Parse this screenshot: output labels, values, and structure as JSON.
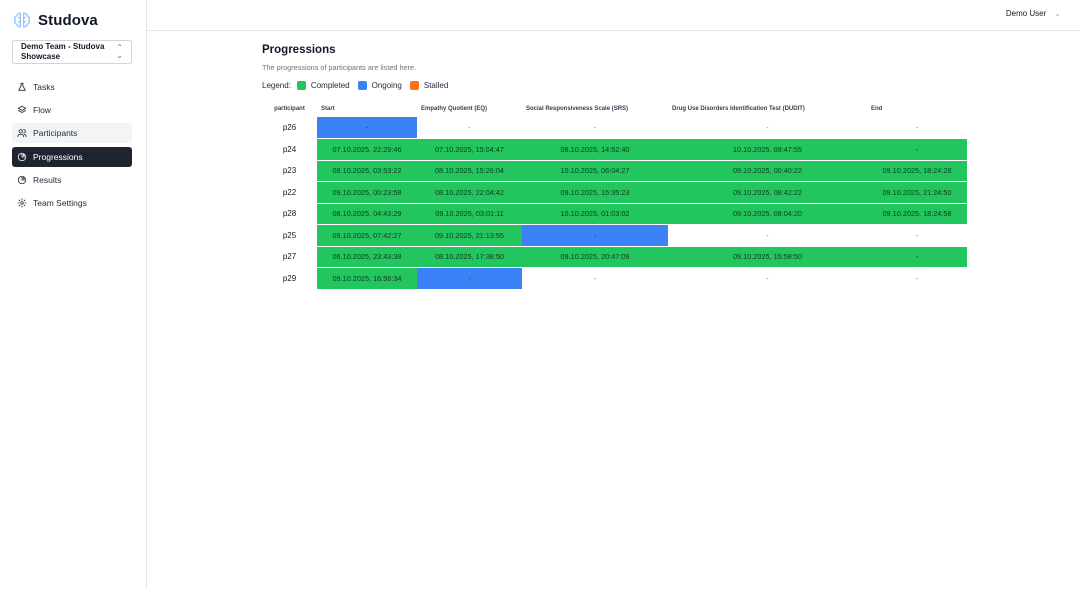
{
  "app": {
    "name": "Studova",
    "team": "Demo Team - Studova Showcase"
  },
  "sidebar": {
    "items": [
      {
        "label": "Tasks",
        "icon": "flask-icon"
      },
      {
        "label": "Flow",
        "icon": "layers-icon"
      },
      {
        "label": "Participants",
        "icon": "users-icon"
      },
      {
        "label": "Progressions",
        "icon": "pie-chart-icon"
      },
      {
        "label": "Results",
        "icon": "pie-chart-icon"
      },
      {
        "label": "Team Settings",
        "icon": "gear-icon"
      }
    ]
  },
  "header": {
    "user": "Demo User"
  },
  "page": {
    "title": "Progressions",
    "subtitle": "The progressions of participants are listed here.",
    "legend_label": "Legend:",
    "legend": [
      {
        "label": "Completed",
        "color": "#22c55e"
      },
      {
        "label": "Ongoing",
        "color": "#3b82f6"
      },
      {
        "label": "Stalled",
        "color": "#f97316"
      }
    ]
  },
  "table": {
    "columns": [
      "participant",
      "Start",
      "Empathy Quotient (EQ)",
      "Social Responsiveness Scale (SRS)",
      "Drug Use Disorders Identification Test (DUDIT)",
      "End"
    ],
    "rows": [
      {
        "participant": "p26",
        "cells": [
          {
            "value": "-",
            "status": "ongoing"
          },
          {
            "value": "-",
            "status": "empty"
          },
          {
            "value": "-",
            "status": "empty"
          },
          {
            "value": "-",
            "status": "empty"
          },
          {
            "value": "-",
            "status": "empty"
          }
        ]
      },
      {
        "participant": "p24",
        "cells": [
          {
            "value": "07.10.2025, 22:29:46",
            "status": "completed"
          },
          {
            "value": "07.10.2025, 15:04:47",
            "status": "completed"
          },
          {
            "value": "08.10.2025, 14:52:40",
            "status": "completed"
          },
          {
            "value": "10.10.2025, 09:47:55",
            "status": "completed"
          },
          {
            "value": "-",
            "status": "completed"
          }
        ]
      },
      {
        "participant": "p23",
        "cells": [
          {
            "value": "08.10.2025, 03:53:22",
            "status": "completed"
          },
          {
            "value": "08.10.2025, 15:26:04",
            "status": "completed"
          },
          {
            "value": "10.10.2025, 06:04:27",
            "status": "completed"
          },
          {
            "value": "09.10.2025, 00:40:22",
            "status": "completed"
          },
          {
            "value": "09.10.2025, 18:24:28",
            "status": "completed"
          }
        ]
      },
      {
        "participant": "p22",
        "cells": [
          {
            "value": "09.10.2025, 00:23:58",
            "status": "completed"
          },
          {
            "value": "08.10.2025, 22:04:42",
            "status": "completed"
          },
          {
            "value": "09.10.2025, 15:35:23",
            "status": "completed"
          },
          {
            "value": "09.10.2025, 08:42:22",
            "status": "completed"
          },
          {
            "value": "09.10.2025, 21:24:50",
            "status": "completed"
          }
        ]
      },
      {
        "participant": "p28",
        "cells": [
          {
            "value": "08.10.2025, 04:43:29",
            "status": "completed"
          },
          {
            "value": "09.10.2025, 03:01:11",
            "status": "completed"
          },
          {
            "value": "10.10.2025, 01:03:02",
            "status": "completed"
          },
          {
            "value": "09.10.2025, 08:04:20",
            "status": "completed"
          },
          {
            "value": "09.10.2025, 18:24:58",
            "status": "completed"
          }
        ]
      },
      {
        "participant": "p25",
        "cells": [
          {
            "value": "09.10.2025, 07:42:27",
            "status": "completed"
          },
          {
            "value": "09.10.2025, 21:13:55",
            "status": "completed"
          },
          {
            "value": "-",
            "status": "ongoing"
          },
          {
            "value": "-",
            "status": "empty"
          },
          {
            "value": "-",
            "status": "empty"
          }
        ]
      },
      {
        "participant": "p27",
        "cells": [
          {
            "value": "06.10.2025, 23:43:38",
            "status": "completed"
          },
          {
            "value": "08.10.2025, 17:38:50",
            "status": "completed"
          },
          {
            "value": "09.10.2025, 20:47:09",
            "status": "completed"
          },
          {
            "value": "09.10.2025, 15:58:50",
            "status": "completed"
          },
          {
            "value": "-",
            "status": "completed"
          }
        ]
      },
      {
        "participant": "p29",
        "cells": [
          {
            "value": "09.10.2025, 16:56:34",
            "status": "completed"
          },
          {
            "value": "-",
            "status": "ongoing"
          },
          {
            "value": "-",
            "status": "empty"
          },
          {
            "value": "-",
            "status": "empty"
          },
          {
            "value": "-",
            "status": "empty"
          }
        ]
      }
    ]
  }
}
